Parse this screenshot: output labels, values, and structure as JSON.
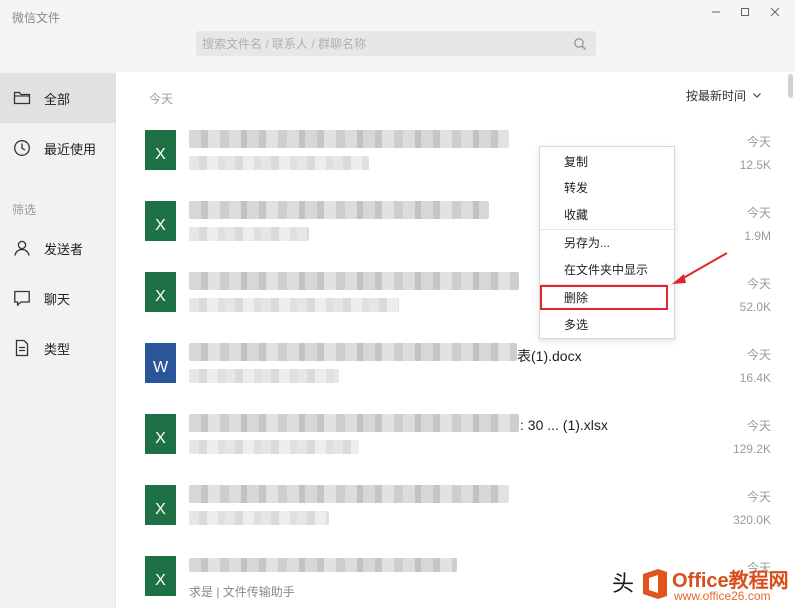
{
  "app": {
    "title": "微信文件"
  },
  "colors": {
    "excel": "#1e7145",
    "word": "#2a5699",
    "highlight": "#e0262b",
    "brand": "#d94f1c"
  },
  "search": {
    "placeholder": "搜索文件名 / 联系人 / 群聊名称",
    "icon": "search-icon"
  },
  "sidebar": {
    "items": [
      {
        "label": "全部",
        "icon": "folder-icon",
        "active": true
      },
      {
        "label": "最近使用",
        "icon": "clock-icon",
        "active": false
      }
    ],
    "filter_label": "筛选",
    "filters": [
      {
        "label": "发送者",
        "icon": "person-icon"
      },
      {
        "label": "聊天",
        "icon": "chat-icon"
      },
      {
        "label": "类型",
        "icon": "document-icon"
      }
    ]
  },
  "main": {
    "date_header": "今天",
    "sort_label": "按最新时间",
    "files": [
      {
        "type": "excel",
        "name": "",
        "sub": "",
        "date": "今天",
        "size": "12.5K"
      },
      {
        "type": "excel",
        "name": "",
        "sub": "",
        "date": "今天",
        "size": "1.9M"
      },
      {
        "type": "excel",
        "name": "",
        "sub": "",
        "date": "今天",
        "size": "52.0K"
      },
      {
        "type": "word",
        "name": "表(1).docx",
        "sub": "",
        "date": "今天",
        "size": "16.4K"
      },
      {
        "type": "excel",
        "name": ": 30 ... (1).xlsx",
        "sub": "",
        "date": "今天",
        "size": "129.2K"
      },
      {
        "type": "excel",
        "name": "",
        "sub": "",
        "date": "今天",
        "size": "320.0K"
      },
      {
        "type": "excel",
        "name": "",
        "sub": "求是 | 文件传输助手",
        "date": "今天",
        "size": ""
      }
    ]
  },
  "context_menu": {
    "items": [
      "复制",
      "转发",
      "收藏",
      "另存为...",
      "在文件夹中显示",
      "删除",
      "多选"
    ]
  },
  "watermark": {
    "prefix": "头",
    "brand": "Office教程网",
    "url": "www.office26.com"
  }
}
